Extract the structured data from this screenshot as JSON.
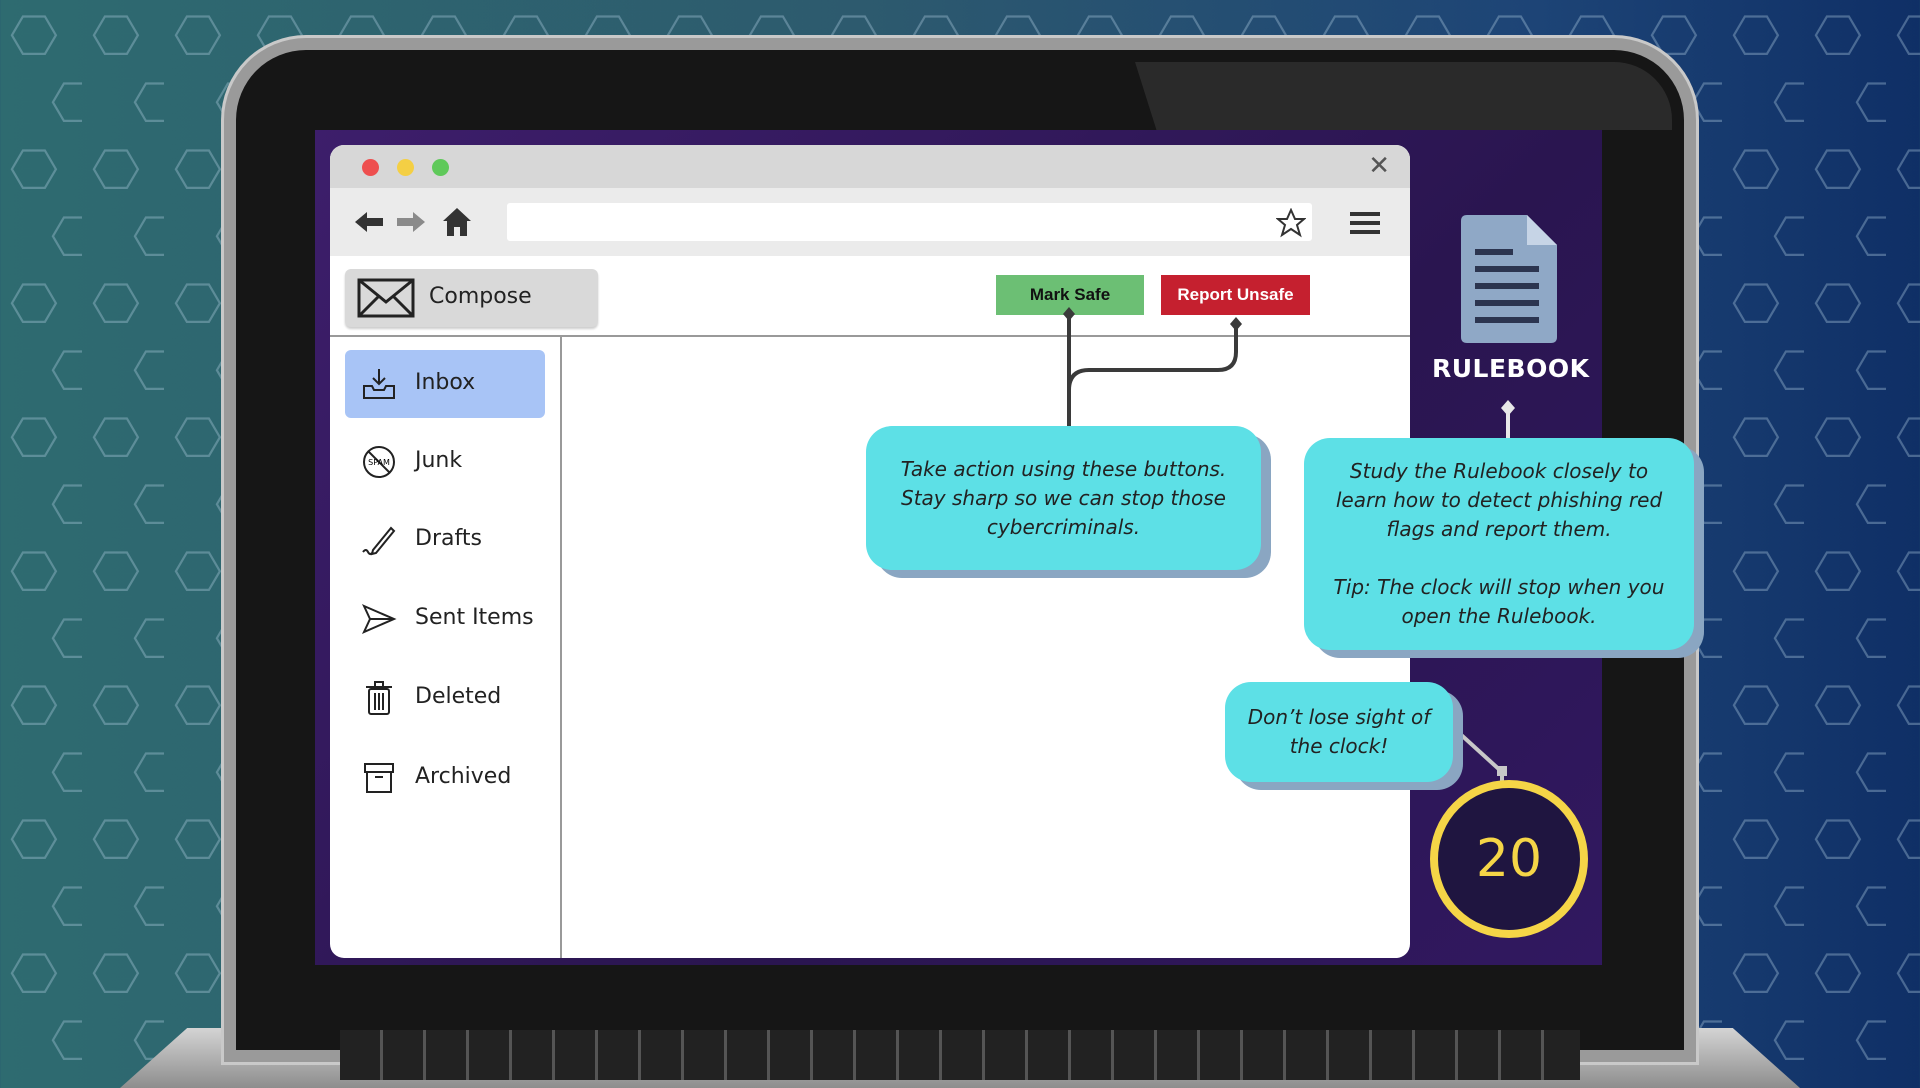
{
  "browser": {
    "window_controls": [
      "close-dot",
      "minimize-dot",
      "maximize-dot"
    ],
    "url": ""
  },
  "mail": {
    "compose_label": "Compose",
    "mark_safe_label": "Mark Safe",
    "report_unsafe_label": "Report Unsafe",
    "folders": [
      {
        "label": "Inbox",
        "icon": "inbox-icon",
        "active": true
      },
      {
        "label": "Junk",
        "icon": "spam-icon",
        "active": false
      },
      {
        "label": "Drafts",
        "icon": "pen-icon",
        "active": false
      },
      {
        "label": "Sent Items",
        "icon": "send-icon",
        "active": false
      },
      {
        "label": "Deleted",
        "icon": "trash-icon",
        "active": false
      },
      {
        "label": "Archived",
        "icon": "archive-icon",
        "active": false
      }
    ],
    "spam_icon_text": "SPAM"
  },
  "rulebook": {
    "title": "RULEBOOK"
  },
  "clock": {
    "value": "20"
  },
  "tips": {
    "buttons_tip": "Take action using these buttons. Stay sharp so we can stop those cybercriminals.",
    "rulebook_tip_1": "Study the Rulebook closely to learn how to detect phishing red flags and report them.",
    "rulebook_tip_2": "Tip: The clock will stop when you open the Rulebook.",
    "clock_tip": "Don’t lose sight of the clock!"
  },
  "colors": {
    "accent_active": "#a8c4f6",
    "safe": "#6cbf74",
    "unsafe": "#c5202f",
    "bubble": "#5de0e6",
    "clock": "#f5d547"
  }
}
